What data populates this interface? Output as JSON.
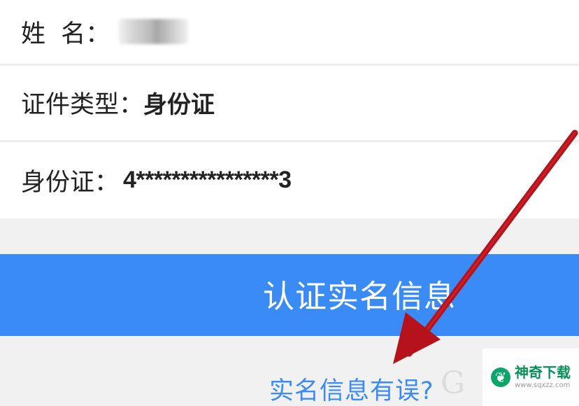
{
  "profile": {
    "name_label": "姓  名：",
    "id_type_label": "证件类型：",
    "id_type_value": "身份证",
    "id_number_label": "身份证：",
    "id_number_value": "4****************3"
  },
  "actions": {
    "verify_button_label": "认证实名信息",
    "error_link_label": "实名信息有误?"
  },
  "watermark": {
    "icon": "leaf-logo-icon",
    "title": "神奇下载",
    "url": "www.sqxzz.com"
  },
  "colors": {
    "accent": "#3a8bf6",
    "arrow": "#b5121b",
    "background": "#f1f1f1",
    "watermark_green": "#0a8f5a"
  }
}
